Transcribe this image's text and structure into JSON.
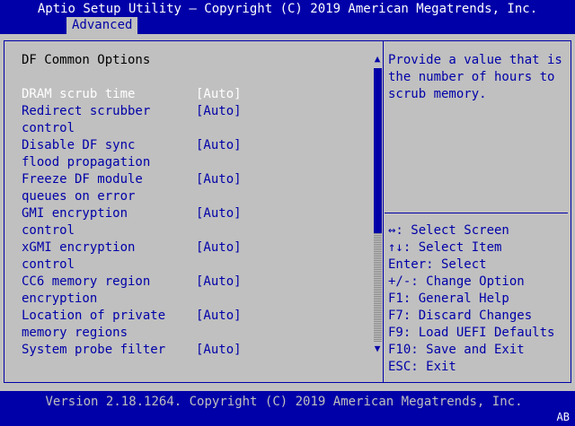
{
  "header": {
    "title": "Aptio Setup Utility – Copyright (C) 2019 American Megatrends, Inc.",
    "active_tab": "Advanced"
  },
  "menu": {
    "title": "DF Common Options",
    "items": [
      {
        "label_lines": [
          "DRAM scrub time"
        ],
        "value": "[Auto]",
        "selected": true
      },
      {
        "label_lines": [
          "Redirect scrubber",
          "control"
        ],
        "value": "[Auto]",
        "selected": false
      },
      {
        "label_lines": [
          "Disable DF sync",
          "flood propagation"
        ],
        "value": "[Auto]",
        "selected": false
      },
      {
        "label_lines": [
          "Freeze DF module",
          "queues on error"
        ],
        "value": "[Auto]",
        "selected": false
      },
      {
        "label_lines": [
          "GMI encryption",
          "control"
        ],
        "value": "[Auto]",
        "selected": false
      },
      {
        "label_lines": [
          "xGMI encryption",
          "control"
        ],
        "value": "[Auto]",
        "selected": false
      },
      {
        "label_lines": [
          "CC6 memory region",
          "encryption"
        ],
        "value": "[Auto]",
        "selected": false
      },
      {
        "label_lines": [
          "Location of private",
          "memory regions"
        ],
        "value": "[Auto]",
        "selected": false
      },
      {
        "label_lines": [
          "System probe filter"
        ],
        "value": "[Auto]",
        "selected": false
      }
    ]
  },
  "help": {
    "lines": [
      "Provide a value that is",
      "the number of hours to",
      "scrub memory."
    ]
  },
  "keys": [
    "↔: Select Screen",
    "↑↓: Select Item",
    "Enter: Select",
    "+/-: Change Option",
    "F1: General Help",
    "F7: Discard Changes",
    "F9: Load UEFI Defaults",
    "F10: Save and Exit",
    "ESC: Exit"
  ],
  "scrollbar": {
    "up_arrow": "▲",
    "down_arrow": "▼",
    "thumb_fraction": 0.6
  },
  "footer": {
    "version": "Version 2.18.1264. Copyright (C) 2019 American Megatrends, Inc.",
    "badge": "AB"
  },
  "colors": {
    "blue": "#0000a8",
    "gray": "#c0c0c0",
    "white": "#ffffff"
  }
}
